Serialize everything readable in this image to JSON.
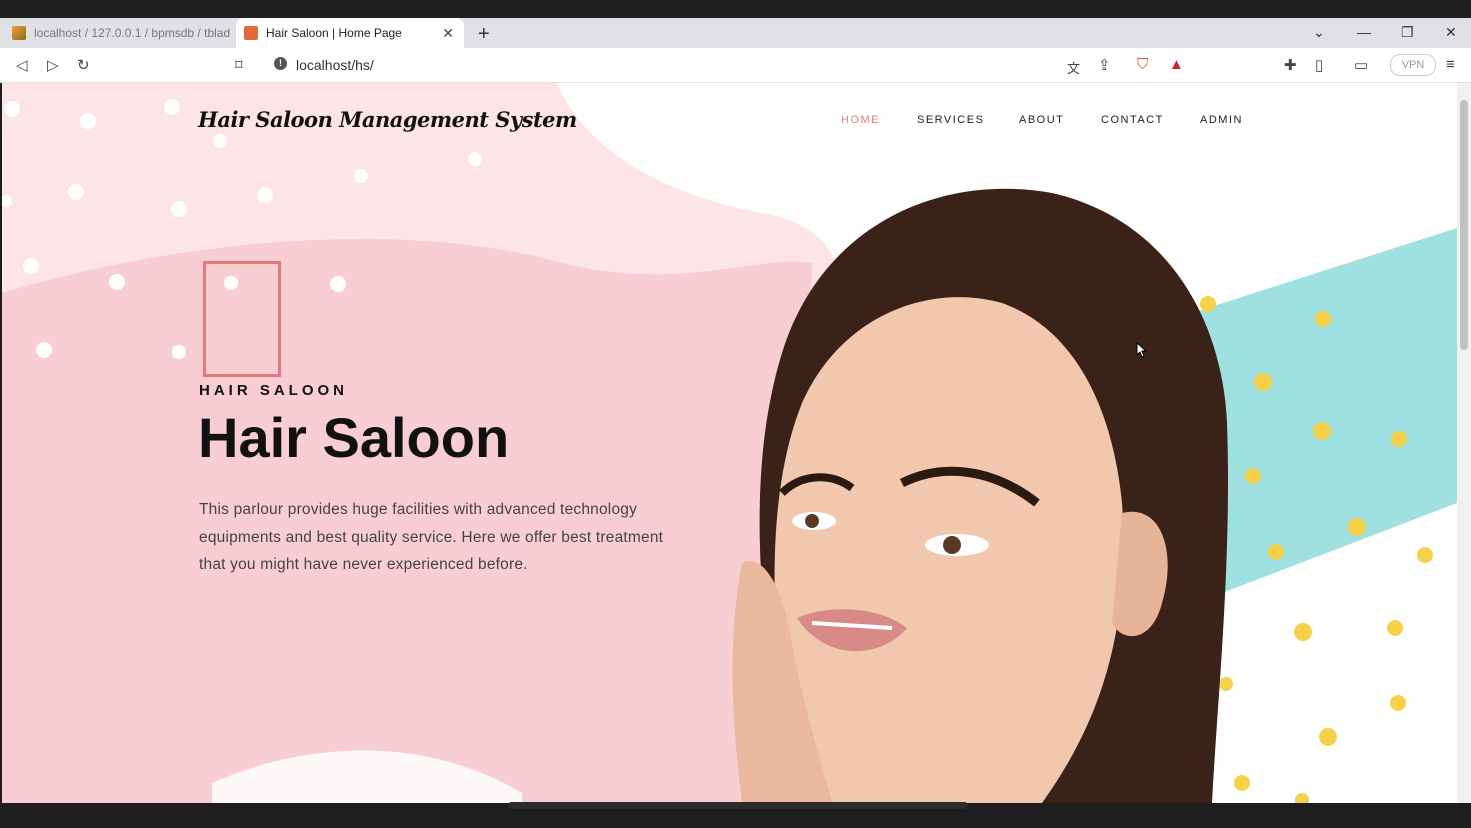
{
  "browser": {
    "tabs": [
      {
        "label": "localhost / 127.0.0.1 / bpmsdb / tblad",
        "active": false
      },
      {
        "label": "Hair Saloon | Home Page",
        "active": true
      }
    ],
    "url": "localhost/hs/",
    "vpn_label": "VPN",
    "icons": [
      "back-icon",
      "forward-icon",
      "reload-icon",
      "bookmark-icon",
      "translate-icon",
      "share-icon",
      "brave-shield-icon",
      "rewards-icon",
      "extensions-icon",
      "sidebar-icon",
      "wallet-icon",
      "menu-icon"
    ]
  },
  "site": {
    "logo": "Hair Saloon Management System",
    "nav": [
      "HOME",
      "SERVICES",
      "ABOUT",
      "CONTACT",
      "ADMIN"
    ],
    "kicker": "HAIR SALOON",
    "title": "Hair Saloon",
    "description": "This parlour provides huge facilities with advanced technology equipments and best quality service. Here we offer best treatment that you might have never experienced before."
  },
  "colors": {
    "accent": "#e57f7f",
    "pink_bg": "#f9cdd4",
    "teal": "#9fe0e0",
    "dot_yellow": "#f5d24a"
  }
}
